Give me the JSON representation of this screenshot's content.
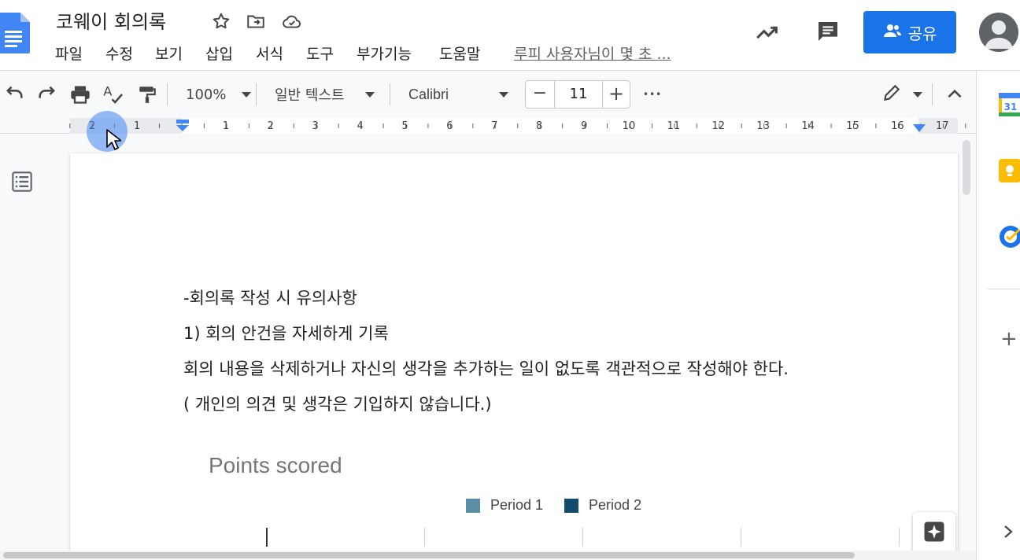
{
  "app": {
    "document_title": "코웨이 회의록",
    "last_edit": "루피 사용자님이 몇 초 ..."
  },
  "menu": [
    "파일",
    "수정",
    "보기",
    "삽입",
    "서식",
    "도구",
    "부가기능",
    "도움말"
  ],
  "share": {
    "label": "공유"
  },
  "toolbar": {
    "zoom": "100%",
    "style": "일반 텍스트",
    "font": "Calibri",
    "font_size": "11",
    "minus_label": "−",
    "plus_label": "+",
    "more_label": "•••"
  },
  "ruler": {
    "left_labels": [
      "2",
      "1"
    ],
    "right_labels": [
      "1",
      "2",
      "3",
      "4",
      "5",
      "6",
      "7",
      "8",
      "9",
      "10",
      "11",
      "12",
      "13",
      "14",
      "15",
      "16",
      "17"
    ]
  },
  "document": {
    "paragraphs": [
      "-회의록 작성 시 유의사항",
      "1) 회의 안건을 자세하게 기록",
      "회의 내용을 삭제하거나 자신의 생각을 추가하는 일이 없도록 객관적으로 작성해야 한다.",
      "( 개인의 의견 및 생각은 기입하지 않습니다.)"
    ]
  },
  "chart_data": {
    "type": "bar",
    "title": "Points scored",
    "series": [
      {
        "name": "Period 1",
        "color": "#5b8fa8"
      },
      {
        "name": "Period 2",
        "color": "#0f4c6e"
      }
    ]
  },
  "side_panel": {
    "calendar_day": "31",
    "add_label": "+"
  },
  "colors": {
    "accent": "#1a73e8",
    "doc_blue": "#4285f4"
  }
}
